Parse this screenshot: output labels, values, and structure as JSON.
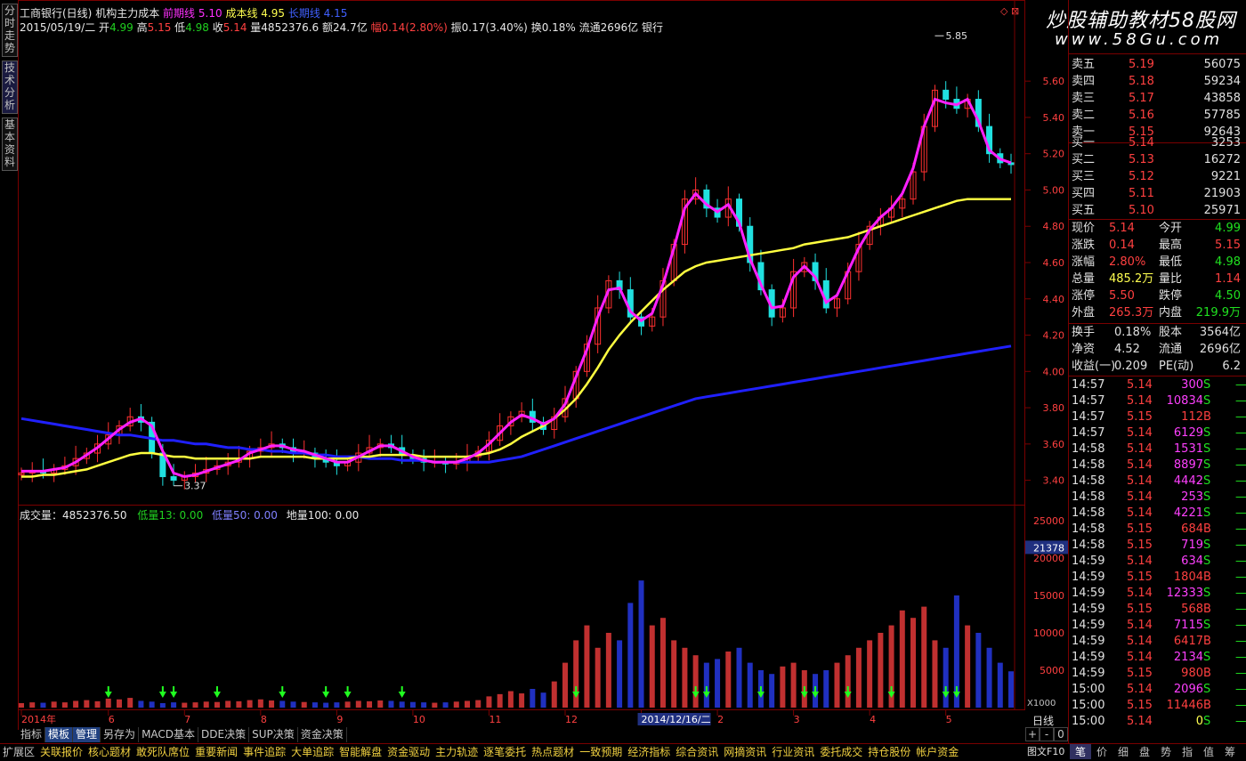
{
  "left_tabs": [
    "分时走势",
    "技术分析",
    "基本资料"
  ],
  "header": {
    "title": "工商银行(日线)",
    "indicator": "机构主力成本",
    "l1_label": "前期线",
    "l1_value": "5.10",
    "l2_label": "成本线",
    "l2_value": "4.95",
    "l3_label": "长期线",
    "l3_value": "4.15",
    "date": "2015/05/19/二",
    "open_label": "开",
    "open": "4.99",
    "high_label": "高",
    "high": "5.15",
    "low_label": "低",
    "low": "4.98",
    "close_label": "收",
    "close": "5.14",
    "vol": "量4852376.6",
    "amount": "额24.7亿",
    "change": "幅0.14(2.80%)",
    "amp": "振0.17(3.40%)",
    "turnover": "换0.18%",
    "float": "流通2696亿",
    "industry": "银行"
  },
  "watermark": {
    "line1": "炒股辅助教材58股网",
    "line2": "www.58Gu.com"
  },
  "price_axis": [
    "5.60",
    "5.40",
    "5.20",
    "5.00",
    "4.80",
    "4.60",
    "4.40",
    "4.20",
    "4.00",
    "3.80",
    "3.60",
    "3.40"
  ],
  "markers": {
    "high": "5.85",
    "low": "3.37"
  },
  "volume": {
    "label": "成交量：4852376.50",
    "ma13_label": "低量13: 0.00",
    "ma50_label": "低量50: 0.00",
    "ma100_label": "地量100: 0.00",
    "axis": [
      "25000",
      "20000",
      "15000",
      "10000",
      "5000"
    ],
    "cursor_value": "21378",
    "unit": "X1000"
  },
  "time_axis": [
    "2014年",
    "6",
    "7",
    "8",
    "9",
    "10",
    "11",
    "12",
    "2014/12/16/二",
    "2",
    "3",
    "4",
    "5"
  ],
  "period": "日线",
  "toolbar": [
    "指标",
    "模板",
    "管理",
    "另存为",
    "MACD基本",
    "DDE决策",
    "SUP决策",
    "资金决策"
  ],
  "toolbar_selected": [
    1,
    2
  ],
  "zoom": [
    "+",
    "-",
    "0"
  ],
  "orderbook": {
    "asks": [
      {
        "label": "卖五",
        "price": "5.19",
        "vol": "56075"
      },
      {
        "label": "卖四",
        "price": "5.18",
        "vol": "59234"
      },
      {
        "label": "卖三",
        "price": "5.17",
        "vol": "43858"
      },
      {
        "label": "卖二",
        "price": "5.16",
        "vol": "57785"
      },
      {
        "label": "卖一",
        "price": "5.15",
        "vol": "92643"
      }
    ],
    "bids": [
      {
        "label": "买一",
        "price": "5.14",
        "vol": "3253"
      },
      {
        "label": "买二",
        "price": "5.13",
        "vol": "16272"
      },
      {
        "label": "买三",
        "price": "5.12",
        "vol": "9221"
      },
      {
        "label": "买四",
        "price": "5.11",
        "vol": "21903"
      },
      {
        "label": "买五",
        "price": "5.10",
        "vol": "25971"
      }
    ]
  },
  "quote": [
    {
      "l": "现价",
      "v": "5.14",
      "vc": "r",
      "l2": "今开",
      "v2": "4.99",
      "v2c": "g"
    },
    {
      "l": "涨跌",
      "v": "0.14",
      "vc": "r",
      "l2": "最高",
      "v2": "5.15",
      "v2c": "r"
    },
    {
      "l": "涨幅",
      "v": "2.80%",
      "vc": "r",
      "l2": "最低",
      "v2": "4.98",
      "v2c": "g"
    },
    {
      "l": "总量",
      "v": "485.2万",
      "vc": "y",
      "l2": "量比",
      "v2": "1.14",
      "v2c": "r"
    },
    {
      "l": "涨停",
      "v": "5.50",
      "vc": "r",
      "l2": "跌停",
      "v2": "4.50",
      "v2c": "g"
    },
    {
      "l": "外盘",
      "v": "265.3万",
      "vc": "r",
      "l2": "内盘",
      "v2": "219.9万",
      "v2c": "g"
    }
  ],
  "fundamentals": [
    {
      "l": "换手",
      "v": "0.18%",
      "l2": "股本",
      "v2": "3564亿"
    },
    {
      "l": "净资",
      "v": "4.52",
      "l2": "流通",
      "v2": "2696亿"
    },
    {
      "l": "收益(一)",
      "v": "0.209",
      "l2": "PE(动)",
      "v2": "6.2"
    }
  ],
  "ticks": [
    {
      "t": "14:57",
      "p": "5.14",
      "v": "300",
      "s": "S"
    },
    {
      "t": "14:57",
      "p": "5.14",
      "v": "10834",
      "s": "S"
    },
    {
      "t": "14:57",
      "p": "5.15",
      "v": "112",
      "s": "B"
    },
    {
      "t": "14:57",
      "p": "5.14",
      "v": "6129",
      "s": "S"
    },
    {
      "t": "14:58",
      "p": "5.14",
      "v": "1531",
      "s": "S"
    },
    {
      "t": "14:58",
      "p": "5.14",
      "v": "8897",
      "s": "S"
    },
    {
      "t": "14:58",
      "p": "5.14",
      "v": "4442",
      "s": "S"
    },
    {
      "t": "14:58",
      "p": "5.14",
      "v": "253",
      "s": "S"
    },
    {
      "t": "14:58",
      "p": "5.14",
      "v": "4221",
      "s": "S"
    },
    {
      "t": "14:58",
      "p": "5.15",
      "v": "684",
      "s": "B"
    },
    {
      "t": "14:58",
      "p": "5.15",
      "v": "719",
      "s": "S"
    },
    {
      "t": "14:59",
      "p": "5.14",
      "v": "634",
      "s": "S"
    },
    {
      "t": "14:59",
      "p": "5.15",
      "v": "1804",
      "s": "B"
    },
    {
      "t": "14:59",
      "p": "5.14",
      "v": "12333",
      "s": "S"
    },
    {
      "t": "14:59",
      "p": "5.15",
      "v": "568",
      "s": "B"
    },
    {
      "t": "14:59",
      "p": "5.14",
      "v": "7115",
      "s": "S"
    },
    {
      "t": "14:59",
      "p": "5.14",
      "v": "6417",
      "s": "B"
    },
    {
      "t": "14:59",
      "p": "5.14",
      "v": "2134",
      "s": "S"
    },
    {
      "t": "14:59",
      "p": "5.15",
      "v": "980",
      "s": "B"
    },
    {
      "t": "15:00",
      "p": "5.14",
      "v": "2096",
      "s": "S"
    },
    {
      "t": "15:00",
      "p": "5.15",
      "v": "11446",
      "s": "B"
    },
    {
      "t": "15:00",
      "p": "5.14",
      "v": "0",
      "s": "S"
    }
  ],
  "right_tabs": [
    "笔",
    "价",
    "细",
    "盘",
    "势",
    "指",
    "值",
    "筹"
  ],
  "bottom_tabs": [
    "扩展区",
    "关联报价",
    "核心题材",
    "敢死队席位",
    "重要新闻",
    "事件追踪",
    "大单追踪",
    "智能解盘",
    "资金驱动",
    "主力轨迹",
    "逐笔委托",
    "热点题材",
    "一致预期",
    "经济指标",
    "综合资讯",
    "网摘资讯",
    "行业资讯",
    "委托成交",
    "持仓股份",
    "帐户资金",
    "图文F10"
  ],
  "colors": {
    "up": "#ff3030",
    "down": "#20e0e0",
    "ma_short": "#ff20ff",
    "ma_mid": "#ffff40",
    "ma_long": "#2020ff",
    "grid": "#7a0000"
  },
  "chart_data": {
    "type": "candlestick",
    "title": "工商银行(日线)",
    "y_range": [
      3.3,
      5.9
    ],
    "volume_range": [
      0,
      25000
    ],
    "volume_unit": "X1000",
    "high_mark": 5.85,
    "low_mark": 3.37,
    "close_series": [
      3.44,
      3.45,
      3.44,
      3.46,
      3.48,
      3.52,
      3.55,
      3.6,
      3.65,
      3.7,
      3.75,
      3.72,
      3.55,
      3.42,
      3.4,
      3.42,
      3.44,
      3.46,
      3.48,
      3.5,
      3.52,
      3.56,
      3.58,
      3.6,
      3.58,
      3.55,
      3.55,
      3.52,
      3.5,
      3.48,
      3.5,
      3.55,
      3.58,
      3.6,
      3.58,
      3.54,
      3.52,
      3.5,
      3.5,
      3.49,
      3.5,
      3.53,
      3.56,
      3.62,
      3.7,
      3.75,
      3.78,
      3.72,
      3.68,
      3.75,
      3.85,
      4.0,
      4.15,
      4.35,
      4.5,
      4.45,
      4.3,
      4.25,
      4.3,
      4.5,
      4.7,
      4.95,
      5.0,
      4.9,
      4.85,
      4.95,
      4.8,
      4.6,
      4.45,
      4.3,
      4.35,
      4.55,
      4.6,
      4.5,
      4.35,
      4.4,
      4.55,
      4.7,
      4.8,
      4.85,
      4.9,
      4.95,
      5.1,
      5.35,
      5.55,
      5.5,
      5.45,
      5.5,
      5.35,
      5.2,
      5.15,
      5.14
    ],
    "ma_short": [
      3.45,
      3.45,
      3.45,
      3.46,
      3.47,
      3.5,
      3.54,
      3.58,
      3.63,
      3.68,
      3.72,
      3.74,
      3.7,
      3.56,
      3.44,
      3.42,
      3.43,
      3.45,
      3.47,
      3.49,
      3.51,
      3.55,
      3.57,
      3.59,
      3.59,
      3.57,
      3.56,
      3.54,
      3.52,
      3.5,
      3.5,
      3.53,
      3.56,
      3.59,
      3.59,
      3.56,
      3.53,
      3.51,
      3.5,
      3.5,
      3.5,
      3.52,
      3.55,
      3.6,
      3.66,
      3.72,
      3.76,
      3.74,
      3.71,
      3.74,
      3.82,
      3.97,
      4.12,
      4.3,
      4.45,
      4.46,
      4.33,
      4.28,
      4.32,
      4.48,
      4.68,
      4.9,
      4.98,
      4.92,
      4.88,
      4.92,
      4.82,
      4.62,
      4.48,
      4.35,
      4.36,
      4.52,
      4.58,
      4.52,
      4.38,
      4.42,
      4.55,
      4.68,
      4.78,
      4.85,
      4.9,
      4.98,
      5.12,
      5.35,
      5.5,
      5.48,
      5.47,
      5.5,
      5.38,
      5.22,
      5.17,
      5.15
    ],
    "ma_mid": [
      3.42,
      3.42,
      3.43,
      3.43,
      3.44,
      3.45,
      3.46,
      3.48,
      3.5,
      3.52,
      3.54,
      3.55,
      3.55,
      3.54,
      3.53,
      3.53,
      3.52,
      3.52,
      3.52,
      3.52,
      3.52,
      3.52,
      3.53,
      3.53,
      3.53,
      3.53,
      3.53,
      3.52,
      3.52,
      3.52,
      3.52,
      3.53,
      3.53,
      3.54,
      3.54,
      3.54,
      3.54,
      3.53,
      3.53,
      3.53,
      3.53,
      3.53,
      3.54,
      3.55,
      3.57,
      3.6,
      3.64,
      3.67,
      3.7,
      3.74,
      3.79,
      3.85,
      3.93,
      4.02,
      4.12,
      4.2,
      4.27,
      4.33,
      4.39,
      4.45,
      4.5,
      4.55,
      4.58,
      4.6,
      4.61,
      4.62,
      4.63,
      4.64,
      4.65,
      4.66,
      4.67,
      4.68,
      4.7,
      4.71,
      4.72,
      4.73,
      4.74,
      4.76,
      4.78,
      4.8,
      4.82,
      4.84,
      4.86,
      4.88,
      4.9,
      4.92,
      4.94,
      4.95,
      4.95,
      4.95,
      4.95,
      4.95
    ],
    "ma_long": [
      3.74,
      3.73,
      3.72,
      3.71,
      3.7,
      3.69,
      3.68,
      3.67,
      3.66,
      3.65,
      3.65,
      3.64,
      3.63,
      3.62,
      3.62,
      3.61,
      3.6,
      3.6,
      3.59,
      3.58,
      3.58,
      3.57,
      3.57,
      3.56,
      3.56,
      3.55,
      3.55,
      3.54,
      3.54,
      3.53,
      3.53,
      3.53,
      3.52,
      3.52,
      3.52,
      3.51,
      3.51,
      3.51,
      3.5,
      3.5,
      3.5,
      3.5,
      3.5,
      3.5,
      3.51,
      3.52,
      3.53,
      3.55,
      3.57,
      3.59,
      3.61,
      3.63,
      3.65,
      3.67,
      3.69,
      3.71,
      3.73,
      3.75,
      3.77,
      3.79,
      3.81,
      3.83,
      3.85,
      3.86,
      3.87,
      3.88,
      3.89,
      3.9,
      3.91,
      3.92,
      3.93,
      3.94,
      3.95,
      3.96,
      3.97,
      3.98,
      3.99,
      4.0,
      4.01,
      4.02,
      4.03,
      4.04,
      4.05,
      4.06,
      4.07,
      4.08,
      4.09,
      4.1,
      4.11,
      4.12,
      4.13,
      4.14
    ],
    "volumes": [
      600,
      700,
      650,
      800,
      700,
      900,
      1000,
      850,
      1200,
      1100,
      1300,
      900,
      800,
      600,
      700,
      650,
      700,
      800,
      750,
      900,
      850,
      1000,
      1100,
      950,
      900,
      800,
      750,
      700,
      650,
      700,
      800,
      900,
      850,
      950,
      900,
      800,
      750,
      700,
      650,
      700,
      800,
      900,
      1000,
      1500,
      1800,
      2200,
      1900,
      2500,
      2000,
      3500,
      6000,
      9000,
      11000,
      8000,
      10000,
      9000,
      14000,
      17000,
      11000,
      12000,
      9000,
      8000,
      7000,
      6000,
      6500,
      7500,
      8000,
      6000,
      5000,
      4500,
      5500,
      6000,
      5000,
      4500,
      5000,
      6000,
      7000,
      8000,
      9000,
      10000,
      11000,
      13000,
      12000,
      13500,
      9000,
      8000,
      15000,
      11000,
      10000,
      8000,
      6000,
      4852
    ]
  }
}
